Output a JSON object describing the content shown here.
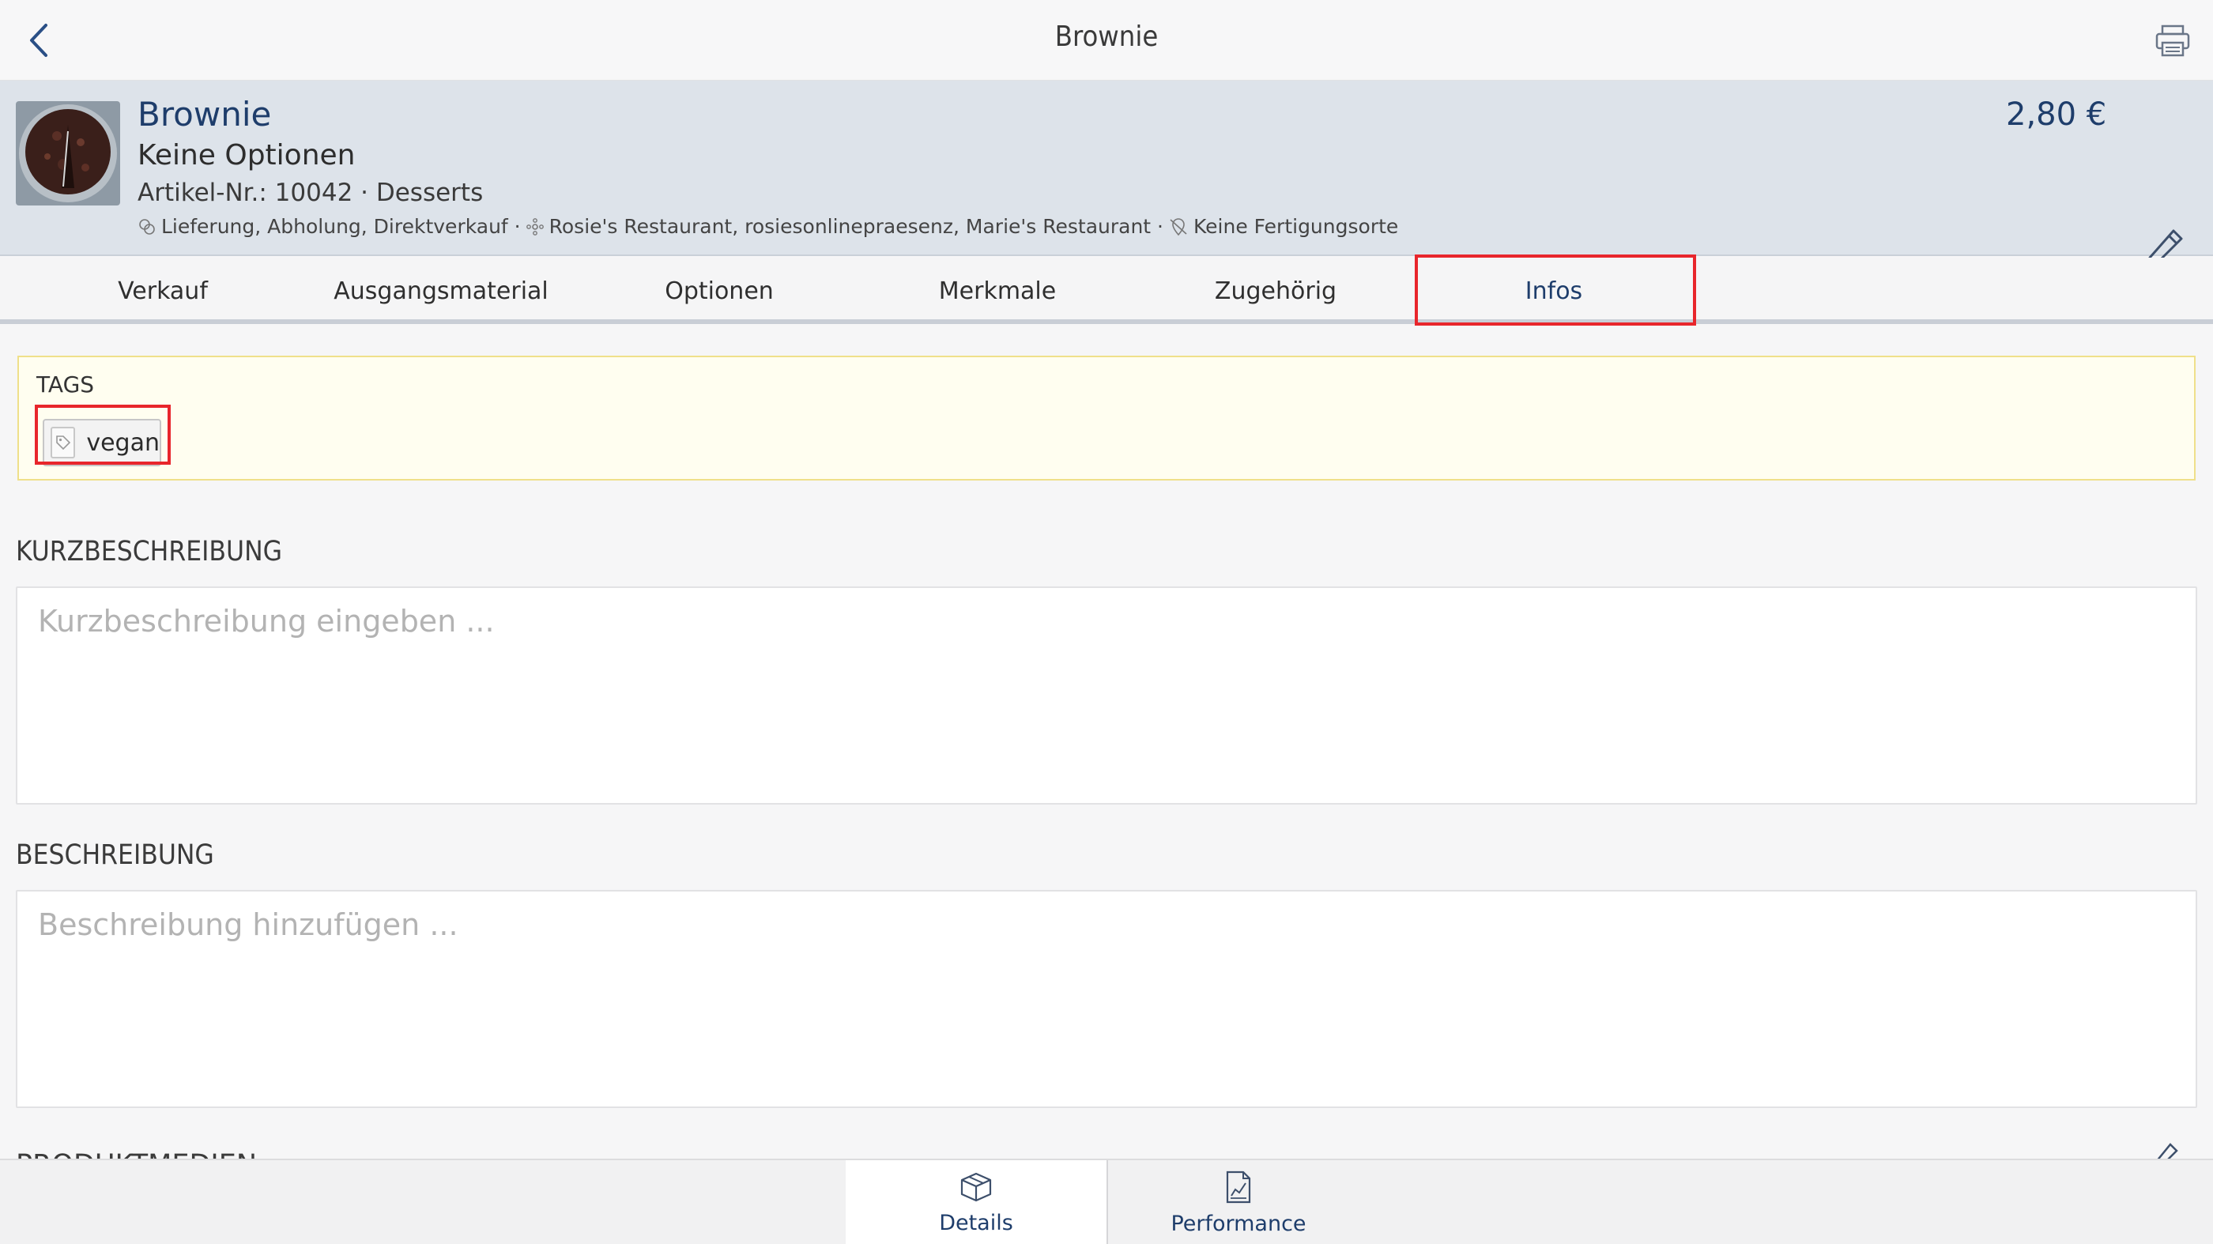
{
  "topbar": {
    "title": "Brownie",
    "back_icon": "chevron-left-icon",
    "print_icon": "printer-icon"
  },
  "product": {
    "name": "Brownie",
    "options": "Keine Optionen",
    "article": "Artikel-Nr.: 10042 · Desserts",
    "price": "2,80 €",
    "meta": {
      "channels": "Lieferung, Abholung, Direktverkauf ·",
      "locations": "Rosie's Restaurant, rosiesonlinepraesenz, Marie's Restaurant ·",
      "production": "Keine Fertigungsorte"
    }
  },
  "tabs": [
    {
      "label": "Verkauf"
    },
    {
      "label": "Ausgangsmaterial"
    },
    {
      "label": "Optionen"
    },
    {
      "label": "Merkmale"
    },
    {
      "label": "Zugehörig"
    },
    {
      "label": "Infos"
    }
  ],
  "active_tab": "Infos",
  "tags": {
    "label": "TAGS",
    "items": [
      {
        "label": "vegan"
      }
    ]
  },
  "short_description": {
    "title": "KURZBESCHREIBUNG",
    "placeholder": "Kurzbeschreibung eingeben ..."
  },
  "description": {
    "title": "BESCHREIBUNG",
    "placeholder": "Beschreibung hinzufügen ..."
  },
  "media": {
    "title": "PRODUKTMEDIEN"
  },
  "bottom_nav": [
    {
      "label": "Details",
      "icon": "box-icon"
    },
    {
      "label": "Performance",
      "icon": "chart-document-icon"
    }
  ],
  "colors": {
    "accent": "#1e3d6b",
    "highlight": "#e8262c",
    "header_bg": "#dde3ea",
    "tags_bg": "#fffef0"
  }
}
